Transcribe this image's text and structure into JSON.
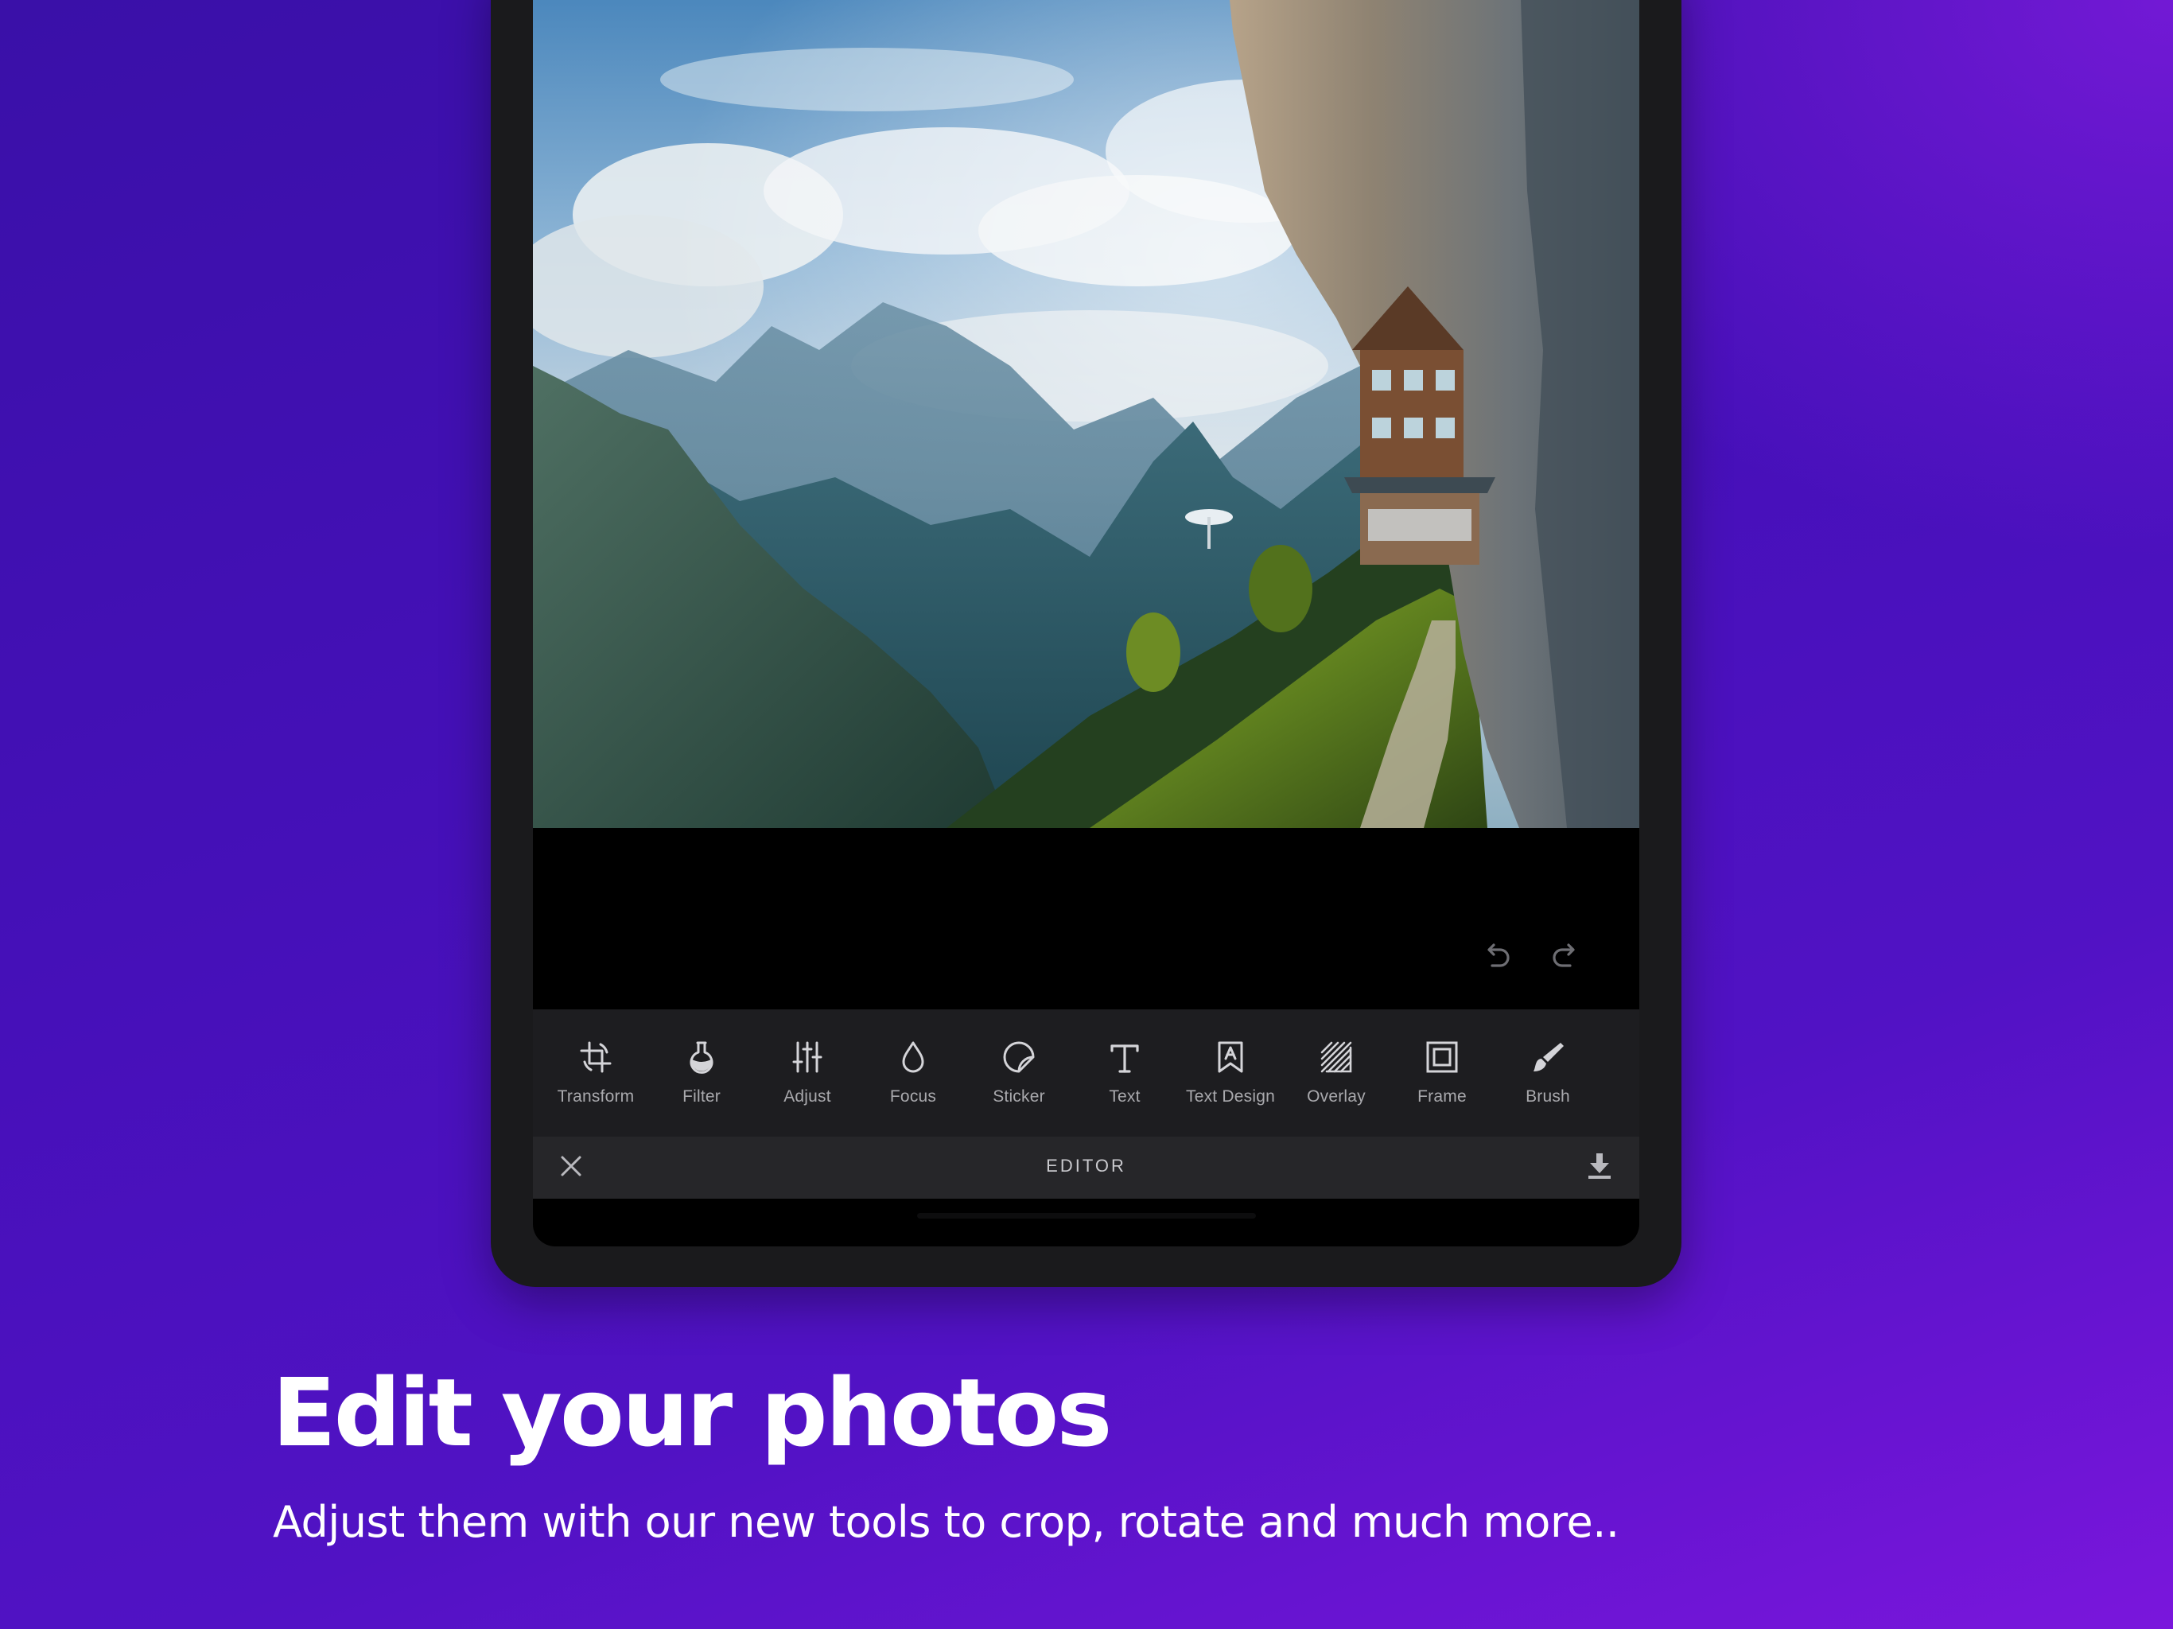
{
  "editor": {
    "tools": [
      {
        "id": "transform",
        "label": "Transform",
        "icon": "crop-rotate-icon"
      },
      {
        "id": "filter",
        "label": "Filter",
        "icon": "flask-icon"
      },
      {
        "id": "adjust",
        "label": "Adjust",
        "icon": "sliders-icon"
      },
      {
        "id": "focus",
        "label": "Focus",
        "icon": "droplet-icon"
      },
      {
        "id": "sticker",
        "label": "Sticker",
        "icon": "sticker-icon"
      },
      {
        "id": "text",
        "label": "Text",
        "icon": "text-t-icon"
      },
      {
        "id": "text-design",
        "label": "Text Design",
        "icon": "bookmark-a-icon"
      },
      {
        "id": "overlay",
        "label": "Overlay",
        "icon": "hatched-square-icon"
      },
      {
        "id": "frame",
        "label": "Frame",
        "icon": "frame-square-icon"
      },
      {
        "id": "brush",
        "label": "Brush",
        "icon": "brush-icon"
      }
    ],
    "title": "EDITOR",
    "icons": {
      "undo": "undo-icon",
      "redo": "redo-icon",
      "close": "close-icon",
      "download": "download-icon"
    }
  },
  "promo": {
    "headline": "Edit your photos",
    "subline": "Adjust them with our new tools to crop, rotate and much more.."
  },
  "colors": {
    "background_start": "#3a10a8",
    "background_end": "#7a16dc",
    "device_frame": "#1a1a1c",
    "toolbar": "#1d1d20",
    "bottombar": "#262629",
    "icon": "#d4d4d8",
    "label": "#a9a9ad"
  }
}
